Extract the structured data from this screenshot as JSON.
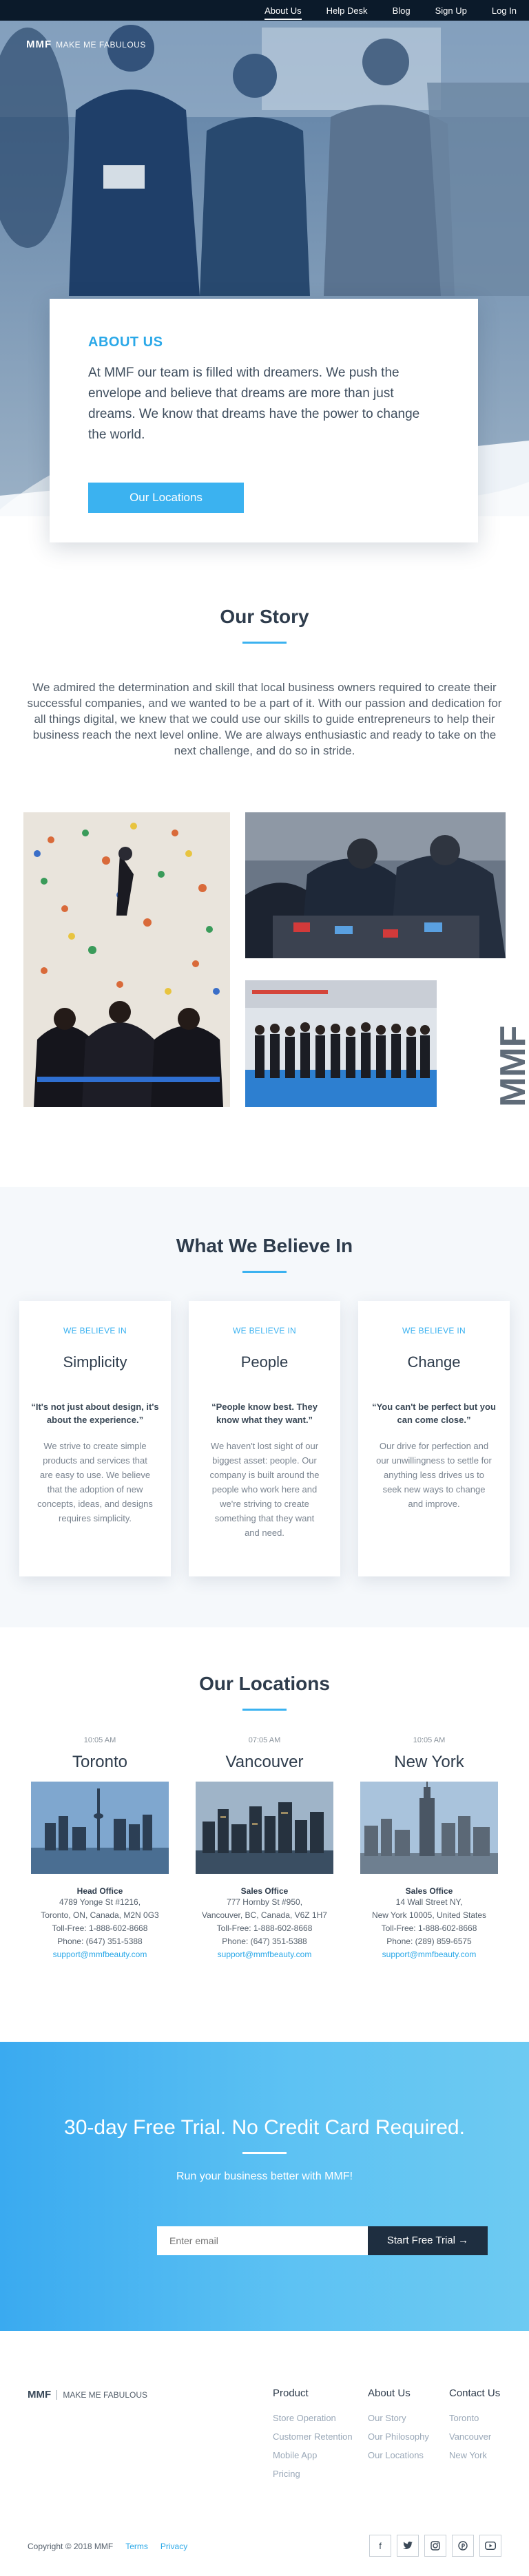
{
  "nav": {
    "items": [
      {
        "label": "About Us",
        "active": true
      },
      {
        "label": "Help Desk"
      },
      {
        "label": "Blog"
      },
      {
        "label": "Sign Up"
      },
      {
        "label": "Log In"
      }
    ]
  },
  "brand": {
    "logo": "MMF",
    "name": "MAKE ME FABULOUS"
  },
  "hero": {
    "heading": "ABOUT US",
    "text": "At MMF our team is filled with dreamers. We push the envelope and believe that dreams are more than just dreams. We know that dreams have the power to change the world.",
    "button": "Our Locations"
  },
  "story": {
    "title": "Our Story",
    "text": "We admired the determination and skill that local business owners required to create their successful companies, and we wanted to be a part of it. With our passion and dedication for all things digital, we knew that we could use our skills to guide entrepreneurs to help their business reach the next level online. We are always enthusiastic and ready to take on the next challenge, and do so in stride.",
    "vertical_logo": "MMF"
  },
  "believe": {
    "title": "What We Believe In",
    "cards": [
      {
        "kicker": "WE BELIEVE IN",
        "title": "Simplicity",
        "quote": "“It's not just about design, it's about the experience.”",
        "body": "We strive to create simple products and services that are easy to use. We believe that the adoption of new concepts, ideas, and designs requires simplicity."
      },
      {
        "kicker": "WE BELIEVE IN",
        "title": "People",
        "quote": "“People know best. They know what they want.”",
        "body": "We haven't lost sight of our biggest asset: people. Our company is built around the people who work here and we're striving to create something that they want and need."
      },
      {
        "kicker": "WE BELIEVE IN",
        "title": "Change",
        "quote": "“You can't be perfect but you can come close.”",
        "body": "Our drive for perfection and our unwillingness to settle for anything less drives us to seek new ways to change and improve."
      }
    ]
  },
  "locations": {
    "title": "Our Locations",
    "items": [
      {
        "time": "10:05 AM",
        "city": "Toronto",
        "office": "Head Office",
        "address1": "4789 Yonge St #1216,",
        "address2": "Toronto, ON, Canada, M2N 0G3",
        "tollfree": "Toll-Free: 1-888-602-8668",
        "phone": "Phone: (647) 351-5388",
        "email": "support@mmfbeauty.com"
      },
      {
        "time": "07:05 AM",
        "city": "Vancouver",
        "office": "Sales Office",
        "address1": "777 Hornby St #950,",
        "address2": "Vancouver, BC, Canada, V6Z 1H7",
        "tollfree": "Toll-Free: 1-888-602-8668",
        "phone": "Phone: (647) 351-5388",
        "email": "support@mmfbeauty.com"
      },
      {
        "time": "10:05 AM",
        "city": "New York",
        "office": "Sales Office",
        "address1": "14 Wall Street NY,",
        "address2": "New York 10005, United States",
        "tollfree": "Toll-Free: 1-888-602-8668",
        "phone": "Phone: (289) 859-6575",
        "email": "support@mmfbeauty.com"
      }
    ]
  },
  "cta": {
    "title": "30-day Free Trial. No Credit Card Required.",
    "subtitle": "Run your business better with MMF!",
    "placeholder": "Enter email",
    "button": "Start Free Trial →"
  },
  "footer": {
    "brand": "MMF",
    "name": "MAKE ME FABULOUS",
    "columns": [
      {
        "title": "Product",
        "links": [
          "Store Operation",
          "Customer Retention",
          "Mobile App",
          "Pricing"
        ]
      },
      {
        "title": "About Us",
        "links": [
          "Our Story",
          "Our Philosophy",
          "Our Locations"
        ]
      },
      {
        "title": "Contact Us",
        "links": [
          "Toronto",
          "Vancouver",
          "New York"
        ]
      }
    ],
    "copyright": "Copyright © 2018 MMF",
    "terms": "Terms",
    "privacy": "Privacy",
    "socials": [
      "f",
      "t",
      "ig",
      "p",
      "yt"
    ]
  }
}
